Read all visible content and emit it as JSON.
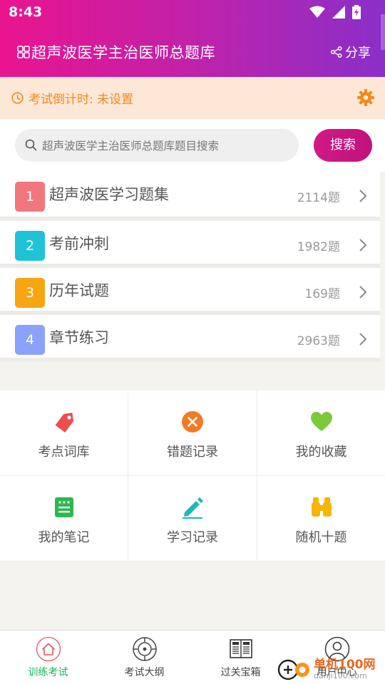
{
  "status_bar": {
    "time": "8:43"
  },
  "header": {
    "title": "超声波医学主治医师总题库",
    "share_label": "分享"
  },
  "countdown": {
    "text": "考试倒计时: 未设置"
  },
  "search": {
    "placeholder": "超声波医学主治医师总题库题目搜索",
    "button_label": "搜索"
  },
  "list": [
    {
      "num": "1",
      "label": "超声波医学习题集",
      "count": "2114题",
      "color": "#f2777c"
    },
    {
      "num": "2",
      "label": "考前冲刺",
      "count": "1982题",
      "color": "#1fc2d6"
    },
    {
      "num": "3",
      "label": "历年试题",
      "count": "169题",
      "color": "#f7a511"
    },
    {
      "num": "4",
      "label": "章节练习",
      "count": "2963题",
      "color": "#8aa2fb"
    }
  ],
  "grid": [
    {
      "label": "考点词库",
      "icon": "tag-icon"
    },
    {
      "label": "错题记录",
      "icon": "close-circle-icon"
    },
    {
      "label": "我的收藏",
      "icon": "heart-icon"
    },
    {
      "label": "我的笔记",
      "icon": "notebook-icon"
    },
    {
      "label": "学习记录",
      "icon": "pencil-icon"
    },
    {
      "label": "随机十题",
      "icon": "binoculars-icon"
    }
  ],
  "bottom_nav": [
    {
      "label": "训练考试",
      "icon": "home-icon",
      "active": true
    },
    {
      "label": "考试大纲",
      "icon": "target-icon",
      "active": false
    },
    {
      "label": "过关宝箱",
      "icon": "newspaper-icon",
      "active": false
    },
    {
      "label": "用户中心",
      "icon": "user-icon",
      "active": false
    }
  ],
  "watermark": {
    "text": "单机100网",
    "url": "danji100.com"
  },
  "colors": {
    "header_start": "#ea148f",
    "header_end": "#8a2fc9",
    "accent_orange": "#f2891a",
    "active_green": "#17b55c"
  }
}
